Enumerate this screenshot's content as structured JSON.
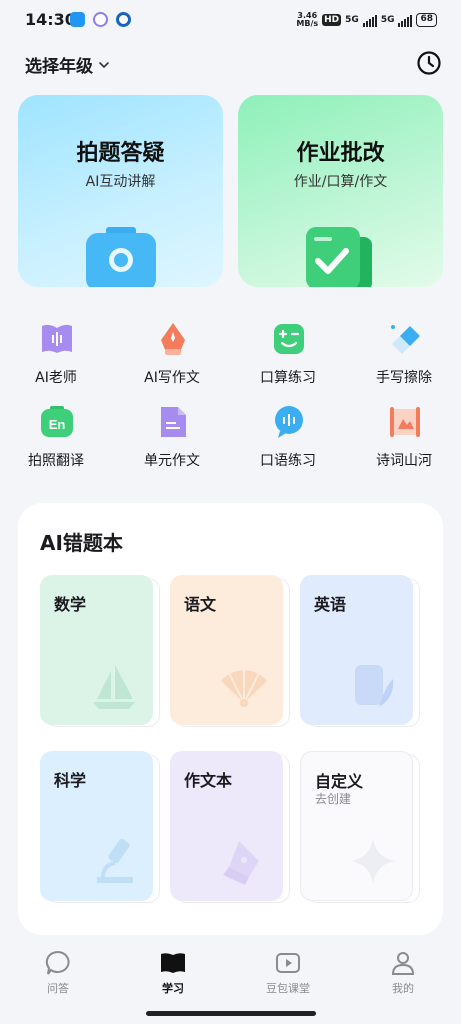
{
  "status_bar": {
    "time": "14:30",
    "speed_value": "3.46",
    "speed_unit": "MB/s",
    "hd_badge": "HD",
    "network_1": "5G",
    "network_2": "5G",
    "battery": "68"
  },
  "header": {
    "grade_selector": "选择年级",
    "history_icon": "clock-icon"
  },
  "hero_cards": [
    {
      "title": "拍题答疑",
      "subtitle": "AI互动讲解",
      "icon": "camera-icon",
      "color": "#4fc3f7"
    },
    {
      "title": "作业批改",
      "subtitle": "作业/口算/作文",
      "icon": "clipboard-check-icon",
      "color": "#2ecc71"
    }
  ],
  "tools": [
    {
      "label": "AI老师",
      "icon": "book-voice-icon"
    },
    {
      "label": "AI写作文",
      "icon": "pen-nib-icon"
    },
    {
      "label": "口算练习",
      "icon": "calculator-face-icon"
    },
    {
      "label": "手写擦除",
      "icon": "eraser-icon"
    },
    {
      "label": "拍照翻译",
      "icon": "en-camera-icon"
    },
    {
      "label": "单元作文",
      "icon": "document-icon"
    },
    {
      "label": "口语练习",
      "icon": "speech-bubble-icon"
    },
    {
      "label": "诗词山河",
      "icon": "scroll-icon"
    }
  ],
  "notebook": {
    "title": "AI错题本",
    "books": [
      {
        "label": "数学",
        "sub": "",
        "icon": "sailboat-icon",
        "color": "#dcf3e8"
      },
      {
        "label": "语文",
        "sub": "",
        "icon": "fan-icon",
        "color": "#fdebdb"
      },
      {
        "label": "英语",
        "sub": "",
        "icon": "scroll-feather-icon",
        "color": "#e0ebfd"
      },
      {
        "label": "科学",
        "sub": "",
        "icon": "microscope-icon",
        "color": "#dcefff"
      },
      {
        "label": "作文本",
        "sub": "",
        "icon": "pen-nib-icon",
        "color": "#ede9fb"
      },
      {
        "label": "自定义",
        "sub": "去创建",
        "icon": "sparkle-icon",
        "color": "#fafafc"
      }
    ]
  },
  "bottom_nav": [
    {
      "label": "问答",
      "icon": "chat-bubble-icon",
      "active": false
    },
    {
      "label": "学习",
      "icon": "open-book-icon",
      "active": true
    },
    {
      "label": "豆包课堂",
      "icon": "play-video-icon",
      "active": false
    },
    {
      "label": "我的",
      "icon": "user-icon",
      "active": false
    }
  ]
}
